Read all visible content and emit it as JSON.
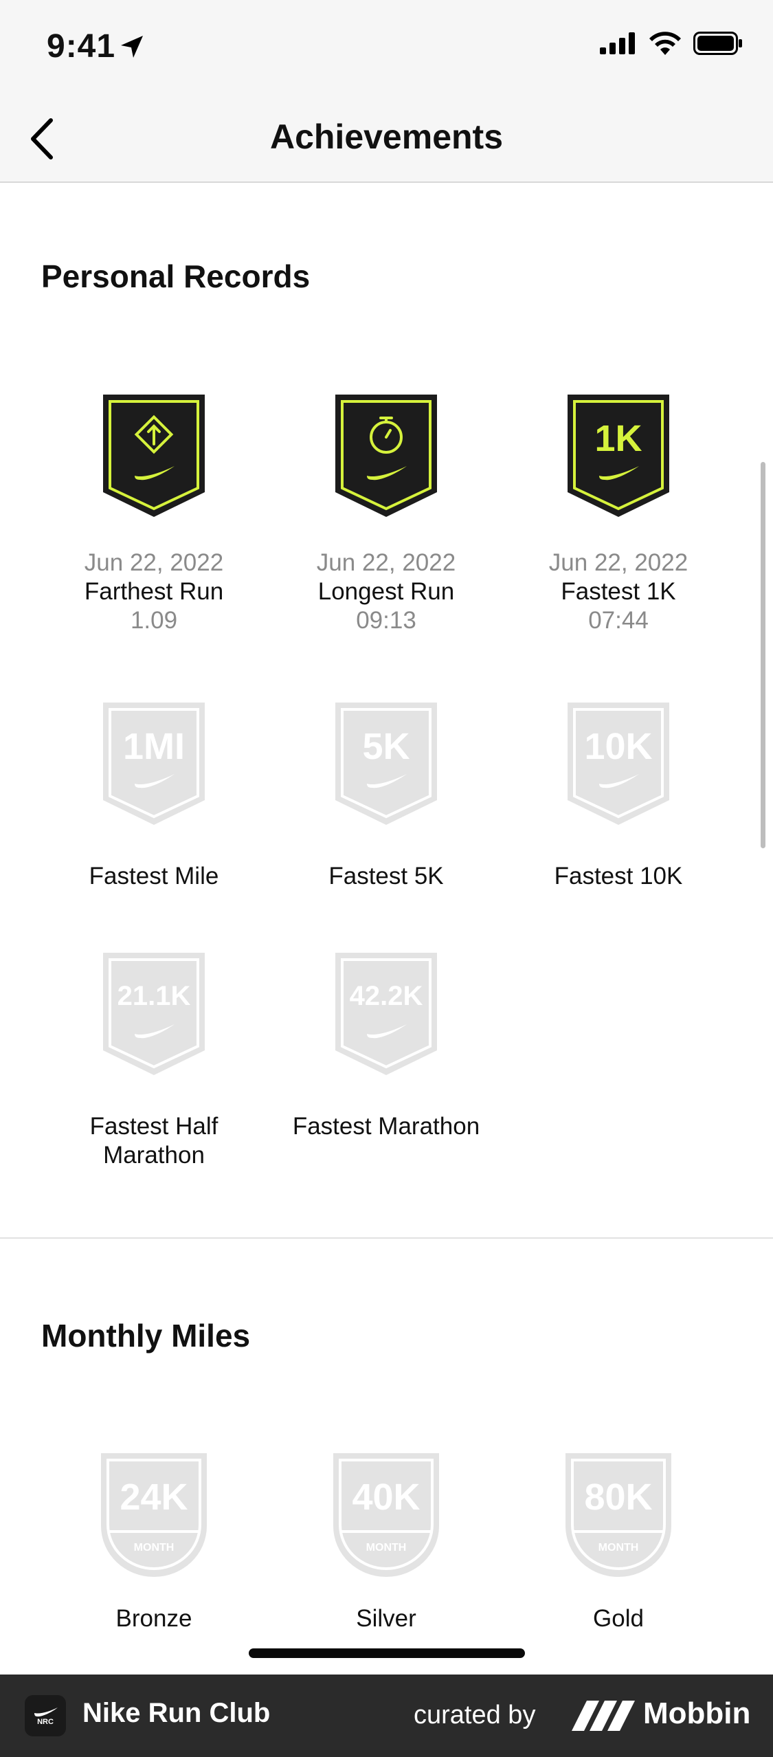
{
  "status_bar": {
    "time": "9:41"
  },
  "nav": {
    "title": "Achievements"
  },
  "personal_records": {
    "title": "Personal Records",
    "items": [
      {
        "date": "Jun 22, 2022",
        "name": "Farthest Run",
        "value": "1.09",
        "icon": "farthest-run-icon",
        "earned": true
      },
      {
        "date": "Jun 22, 2022",
        "name": "Longest Run",
        "value": "09:13",
        "icon": "stopwatch-icon",
        "earned": true
      },
      {
        "date": "Jun 22, 2022",
        "name": "Fastest 1K",
        "value": "07:44",
        "icon_text": "1K",
        "earned": true
      },
      {
        "name": "Fastest Mile",
        "icon_text": "1MI",
        "earned": false
      },
      {
        "name": "Fastest 5K",
        "icon_text": "5K",
        "earned": false
      },
      {
        "name": "Fastest 10K",
        "icon_text": "10K",
        "earned": false
      },
      {
        "name": "Fastest Half Marathon",
        "icon_text": "21.1K",
        "earned": false
      },
      {
        "name": "Fastest Marathon",
        "icon_text": "42.2K",
        "earned": false
      }
    ]
  },
  "monthly_miles": {
    "title": "Monthly Miles",
    "items": [
      {
        "name": "Bronze",
        "icon_text": "24K",
        "icon_sub": "MONTH",
        "earned": false
      },
      {
        "name": "Silver",
        "icon_text": "40K",
        "icon_sub": "MONTH",
        "earned": false
      },
      {
        "name": "Gold",
        "icon_text": "80K",
        "icon_sub": "MONTH",
        "earned": false
      }
    ]
  },
  "footer": {
    "logo_text": "NRC",
    "app_name": "Nike Run Club",
    "curated_by": "curated by",
    "brand": "Mobbin"
  },
  "colors": {
    "badge_dark": "#1c1c1c",
    "badge_accent": "#d6f23c",
    "badge_locked": "#e3e3e3",
    "footer_bg": "#2b2b2b"
  }
}
